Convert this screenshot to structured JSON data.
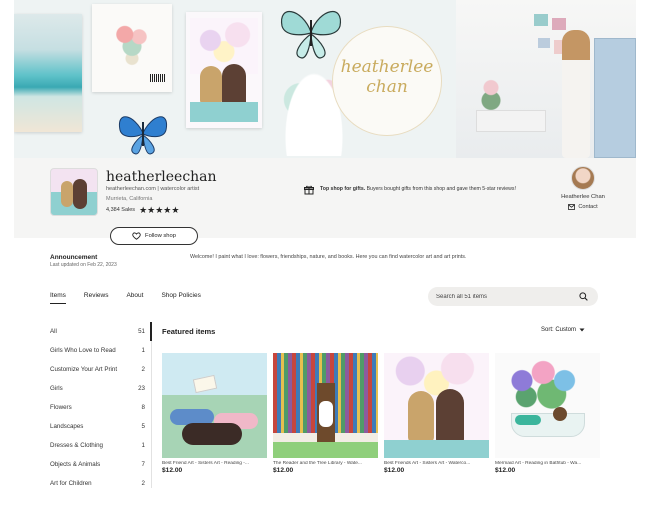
{
  "banner": {
    "logo_line1": "heatherlee",
    "logo_line2": "chan"
  },
  "shop": {
    "name": "heatherleechan",
    "subtitle": "heatherleechan.com | watercolor artist",
    "location": "Murrieta, California",
    "sales": "4,384 Sales",
    "rating_stars": "★★★★★",
    "rating": 5,
    "follow_label": "Follow shop",
    "gift_bold": "Top shop for gifts.",
    "gift_text": " Buyers bought gifts from this shop and gave them 5-star reviews!"
  },
  "owner": {
    "name": "Heatherlee Chan",
    "contact_label": "Contact"
  },
  "announcement": {
    "title": "Announcement",
    "date": "Last updated on Feb 22, 2023",
    "message": "Welcome! I paint what I love: flowers, friendships, nature, and books. Here you can find watercolor art and art prints."
  },
  "tabs": [
    {
      "label": "Items",
      "active": true
    },
    {
      "label": "Reviews",
      "active": false
    },
    {
      "label": "About",
      "active": false
    },
    {
      "label": "Shop Policies",
      "active": false
    }
  ],
  "search": {
    "placeholder": "Search all 51 items"
  },
  "categories": [
    {
      "label": "All",
      "count": "51"
    },
    {
      "label": "Girls Who Love to Read",
      "count": "1"
    },
    {
      "label": "Customize Your Art Print",
      "count": "2"
    },
    {
      "label": "Girls",
      "count": "23"
    },
    {
      "label": "Flowers",
      "count": "8"
    },
    {
      "label": "Landscapes",
      "count": "5"
    },
    {
      "label": "Dresses & Clothing",
      "count": "1"
    },
    {
      "label": "Objects & Animals",
      "count": "7"
    },
    {
      "label": "Art for Children",
      "count": "2"
    }
  ],
  "featured": {
    "title": "Featured items",
    "sort_label": "Sort: Custom"
  },
  "items": [
    {
      "title": "Best Friend Art - Sisters Art - Reading -...",
      "price": "$12.00"
    },
    {
      "title": "The Reader and the Tree Library - Wate...",
      "price": "$12.00"
    },
    {
      "title": "Best Friends Art - Sisters Art - Waterco...",
      "price": "$12.00"
    },
    {
      "title": "Mermaid Art - Reading in Bathtub - Wa...",
      "price": "$12.00"
    }
  ],
  "colors": {
    "accent": "#222222",
    "band": "#f5f5f4",
    "search_bg": "#efeeec"
  }
}
